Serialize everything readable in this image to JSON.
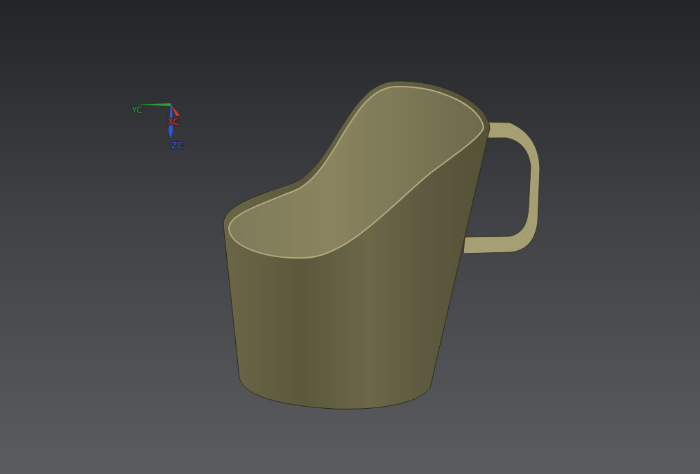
{
  "viewport": {
    "triad": {
      "axes": [
        {
          "kind": "horizontal",
          "label": "YC",
          "color": "#2fa02f"
        },
        {
          "kind": "diagonal",
          "label": "XC",
          "color": "#d8322a"
        },
        {
          "kind": "vertical",
          "label": "ZC",
          "color": "#2f55d8"
        }
      ]
    }
  }
}
